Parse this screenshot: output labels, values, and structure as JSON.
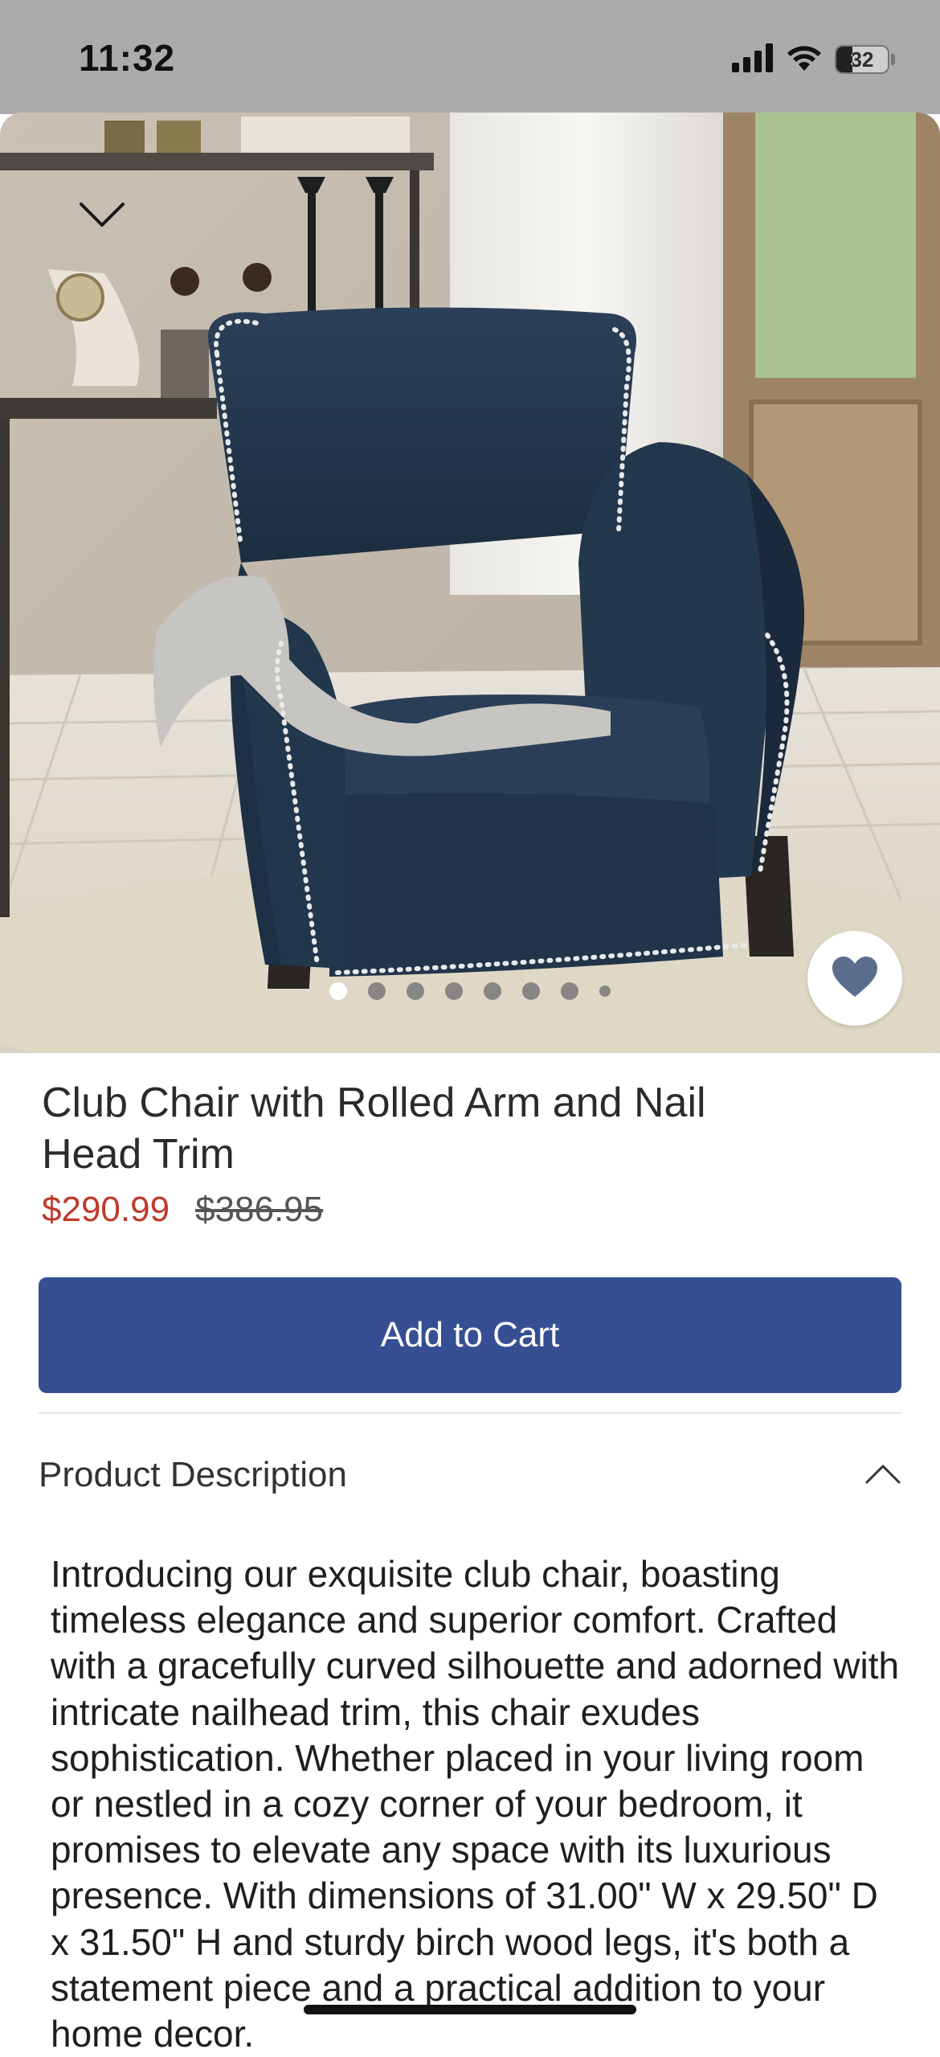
{
  "status_bar": {
    "time": "11:32",
    "battery_level": "32",
    "battery_fraction": 0.32,
    "icons": [
      "signal-icon",
      "wifi-icon",
      "battery-icon"
    ]
  },
  "gallery": {
    "image_count": 8,
    "active_index": 0,
    "favorite_icon": "heart-icon",
    "collapse_icon": "chevron-down-icon"
  },
  "product": {
    "title": "Club Chair with Rolled Arm and Nail Head Trim",
    "sale_price": "$290.99",
    "original_price": "$386.95"
  },
  "actions": {
    "add_to_cart_label": "Add to Cart"
  },
  "description": {
    "header_label": "Product Description",
    "toggle_icon": "chevron-up-icon",
    "expanded": true,
    "text": "Introducing our exquisite club chair, boasting timeless elegance and superior comfort. Crafted with a gracefully curved silhouette and adorned with intricate nailhead trim, this chair exudes sophistication. Whether placed in your living room or nestled in a cozy corner of your bedroom, it promises to elevate any space with its luxurious presence. With dimensions of 31.00\" W x 29.50\" D x 31.50\" H and sturdy birch wood legs, it's both a statement piece and a practical addition to your home decor."
  },
  "colors": {
    "status_bar_bg": "#ababab",
    "sale_price": "#c0392b",
    "button_bg": "#364f92",
    "chair_fabric": "#23374d",
    "favorite_heart": "#5a6e8c"
  }
}
